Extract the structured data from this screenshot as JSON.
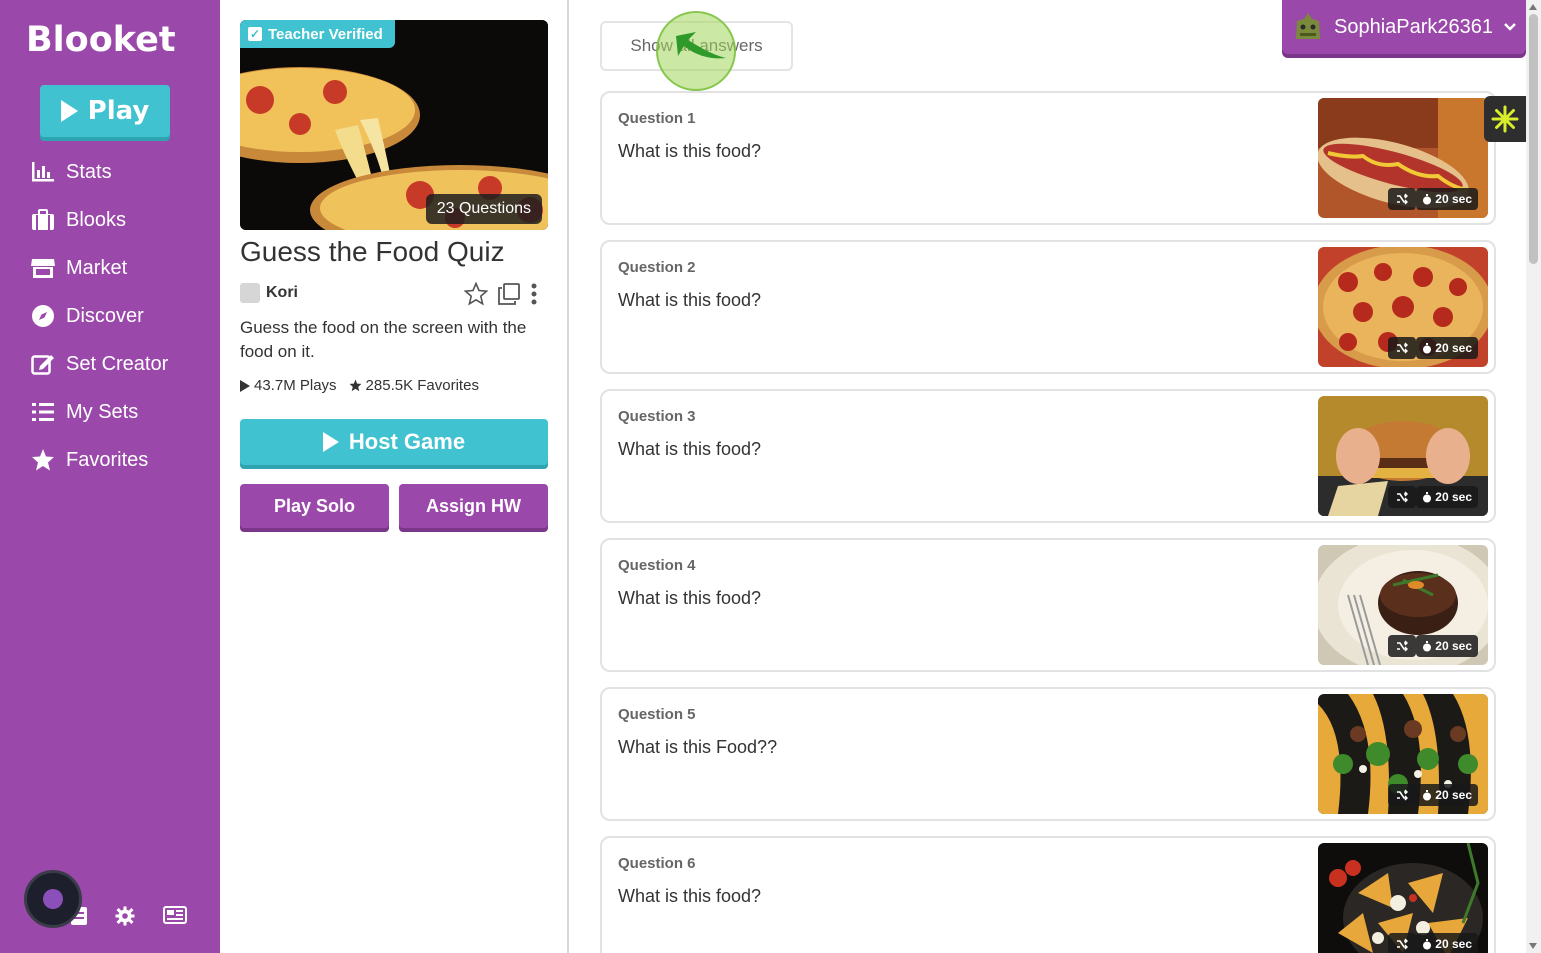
{
  "sidebar": {
    "logo": "Blooket",
    "play_label": "Play",
    "items": [
      {
        "label": "Stats",
        "icon": "bar-chart-icon"
      },
      {
        "label": "Blooks",
        "icon": "briefcase-icon"
      },
      {
        "label": "Market",
        "icon": "store-icon"
      },
      {
        "label": "Discover",
        "icon": "compass-icon"
      },
      {
        "label": "Set Creator",
        "icon": "edit-icon"
      },
      {
        "label": "My Sets",
        "icon": "list-icon"
      },
      {
        "label": "Favorites",
        "icon": "star-icon"
      }
    ]
  },
  "set": {
    "badge": "Teacher Verified",
    "question_count": "23 Questions",
    "title": "Guess the Food Quiz",
    "author": "Kori",
    "description": "Guess the food on the screen with the food on it.",
    "plays": "43.7M Plays",
    "favorites": "285.5K Favorites",
    "host_label": "Host Game",
    "play_solo_label": "Play Solo",
    "assign_hw_label": "Assign HW"
  },
  "main": {
    "show_answers_label": "Show all answers",
    "questions": [
      {
        "number": "Question 1",
        "text": "What is this food?",
        "time": "20 sec",
        "image": "hot-dog"
      },
      {
        "number": "Question 2",
        "text": "What is this food?",
        "time": "20 sec",
        "image": "pizza"
      },
      {
        "number": "Question 3",
        "text": "What is this food?",
        "time": "20 sec",
        "image": "burger"
      },
      {
        "number": "Question 4",
        "text": "What is this food?",
        "time": "20 sec",
        "image": "steak"
      },
      {
        "number": "Question 5",
        "text": "What is this Food??",
        "time": "20 sec",
        "image": "tacos"
      },
      {
        "number": "Question 6",
        "text": "What is this food?",
        "time": "20 sec",
        "image": "nachos"
      }
    ]
  },
  "user": {
    "name": "SophiaPark26361"
  },
  "colors": {
    "sidebar": "#9a49aa",
    "accent": "#40c2d0"
  }
}
